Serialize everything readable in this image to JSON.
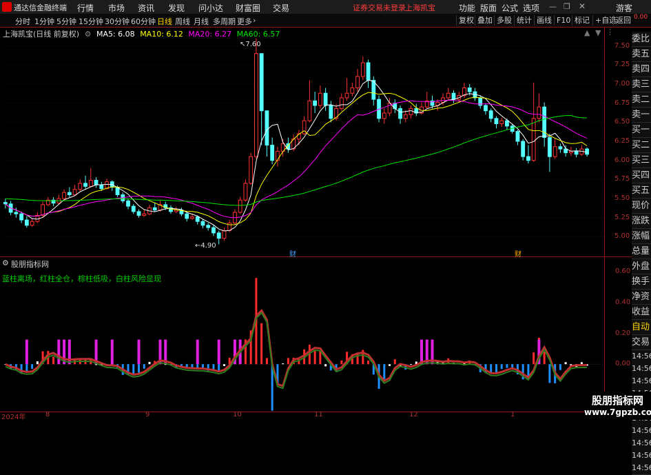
{
  "app": {
    "title": "通达信金融终端",
    "status": "证券交易未登录",
    "stock": "上海凯宝",
    "guest": "游客"
  },
  "menu": [
    "行情",
    "市场",
    "资讯",
    "发现",
    "问小达",
    "财富圈",
    "交易"
  ],
  "menu_right": [
    "功能",
    "版面",
    "公式",
    "选项"
  ],
  "periods": [
    "分时",
    "1分钟",
    "5分钟",
    "15分钟",
    "30分钟",
    "60分钟",
    "日线",
    "周线",
    "月线",
    "多周期",
    "更多"
  ],
  "active_period": "日线",
  "tools": [
    "复权",
    "叠加",
    "多股",
    "统计",
    "画线",
    "F10",
    "标记",
    "+自选",
    "返回"
  ],
  "legend": {
    "name": "上海凯宝(日线 前复权)",
    "ma5": "MA5: 6.08",
    "ma10": "MA10: 6.12",
    "ma20": "MA20: 6.27",
    "ma60": "MA60: 6.57"
  },
  "price_axis": [
    "7.50",
    "7.25",
    "7.00",
    "6.75",
    "6.50",
    "6.25",
    "6.00",
    "5.75",
    "5.50",
    "5.25",
    "5.00"
  ],
  "high_label": "7.60",
  "low_label": "4.90",
  "markers": [
    "财",
    "财"
  ],
  "indicator": {
    "name": "股朋指标网",
    "legend": "蓝柱离场，红柱全仓，棕柱低吸，白柱风险显现"
  },
  "indicator_axis": [
    "0.60",
    "0.40",
    "0.20",
    "0.00"
  ],
  "date_axis": [
    "2024年",
    "8",
    "9",
    "10",
    "11",
    "12",
    "1"
  ],
  "right_panel": [
    "委比",
    "卖五",
    "卖四",
    "卖三",
    "卖二",
    "卖一",
    "买一",
    "买二",
    "买三",
    "买四",
    "买五",
    "现价",
    "涨跌",
    "涨幅",
    "总量",
    "外盘",
    "换手",
    "净资",
    "收益",
    "自动",
    "交易"
  ],
  "right_times": [
    "14:56",
    "14:56",
    "14:56",
    "14:56",
    "14:56",
    "14:56",
    "14:56",
    "14:56",
    "14:56",
    "14:56"
  ],
  "corner": "0.00",
  "watermark": {
    "line1": "股朋指标网",
    "line2": "www.7gpzb.com"
  },
  "colors": {
    "up": "#ff3232",
    "down": "#54ffff",
    "ma5": "#ffffff",
    "ma10": "#ffff00",
    "ma20": "#ff00ff",
    "ma60": "#00e600",
    "axis": "#b03030"
  },
  "chart_data": {
    "type": "candlestick",
    "price_range": [
      4.85,
      7.65
    ],
    "candles": [
      [
        5.45,
        5.43,
        5.5,
        5.37
      ],
      [
        5.43,
        5.32,
        5.47,
        5.28
      ],
      [
        5.32,
        5.3,
        5.38,
        5.25
      ],
      [
        5.3,
        5.22,
        5.33,
        5.18
      ],
      [
        5.22,
        5.15,
        5.27,
        5.12
      ],
      [
        5.15,
        5.2,
        5.24,
        5.13
      ],
      [
        5.2,
        5.28,
        5.32,
        5.18
      ],
      [
        5.28,
        5.42,
        5.46,
        5.26
      ],
      [
        5.42,
        5.48,
        5.52,
        5.4
      ],
      [
        5.48,
        5.44,
        5.52,
        5.4
      ],
      [
        5.44,
        5.5,
        5.55,
        5.42
      ],
      [
        5.5,
        5.58,
        5.62,
        5.48
      ],
      [
        5.58,
        5.55,
        5.65,
        5.52
      ],
      [
        5.55,
        5.62,
        5.68,
        5.54
      ],
      [
        5.62,
        5.7,
        5.75,
        5.6
      ],
      [
        5.7,
        5.66,
        5.8,
        5.63
      ],
      [
        5.66,
        5.74,
        5.9,
        5.65
      ],
      [
        5.74,
        5.68,
        5.78,
        5.64
      ],
      [
        5.68,
        5.63,
        5.72,
        5.6
      ],
      [
        5.63,
        5.72,
        5.76,
        5.62
      ],
      [
        5.72,
        5.65,
        5.74,
        5.6
      ],
      [
        5.65,
        5.55,
        5.67,
        5.52
      ],
      [
        5.55,
        5.47,
        5.58,
        5.44
      ],
      [
        5.47,
        5.4,
        5.5,
        5.36
      ],
      [
        5.4,
        5.33,
        5.43,
        5.3
      ],
      [
        5.33,
        5.28,
        5.36,
        5.25
      ],
      [
        5.28,
        5.3,
        5.35,
        5.26
      ],
      [
        5.3,
        5.38,
        5.42,
        5.28
      ],
      [
        5.38,
        5.35,
        5.45,
        5.33
      ],
      [
        5.35,
        5.42,
        5.47,
        5.33
      ],
      [
        5.42,
        5.38,
        5.46,
        5.35
      ],
      [
        5.38,
        5.33,
        5.41,
        5.3
      ],
      [
        5.33,
        5.35,
        5.39,
        5.31
      ],
      [
        5.35,
        5.3,
        5.38,
        5.27
      ],
      [
        5.3,
        5.24,
        5.33,
        5.2
      ],
      [
        5.24,
        5.26,
        5.3,
        5.22
      ],
      [
        5.26,
        5.2,
        5.28,
        5.16
      ],
      [
        5.2,
        5.15,
        5.23,
        5.11
      ],
      [
        5.15,
        5.12,
        5.18,
        5.08
      ],
      [
        5.12,
        5.05,
        5.15,
        5.01
      ],
      [
        5.05,
        4.98,
        5.08,
        4.9
      ],
      [
        4.98,
        5.08,
        5.12,
        4.95
      ],
      [
        5.08,
        5.18,
        5.22,
        5.06
      ],
      [
        5.18,
        5.32,
        5.36,
        5.16
      ],
      [
        5.32,
        5.48,
        5.52,
        5.3
      ],
      [
        5.48,
        5.7,
        5.75,
        5.46
      ],
      [
        5.7,
        6.05,
        6.1,
        5.68
      ],
      [
        6.05,
        7.4,
        7.6,
        6.02
      ],
      [
        7.4,
        6.65,
        6.9,
        6.2
      ],
      [
        6.65,
        6.2,
        6.4,
        6.05
      ],
      [
        6.2,
        6.0,
        6.3,
        5.95
      ],
      [
        6.0,
        6.12,
        6.18,
        5.92
      ],
      [
        6.12,
        6.22,
        6.28,
        6.05
      ],
      [
        6.22,
        6.15,
        6.3,
        6.1
      ],
      [
        6.15,
        6.28,
        6.34,
        6.12
      ],
      [
        6.28,
        6.35,
        6.4,
        6.2
      ],
      [
        6.35,
        6.52,
        6.58,
        6.33
      ],
      [
        6.52,
        6.78,
        7.05,
        6.5
      ],
      [
        6.78,
        6.72,
        6.9,
        6.62
      ],
      [
        6.72,
        6.88,
        6.98,
        6.68
      ],
      [
        6.88,
        6.72,
        6.95,
        6.65
      ],
      [
        6.72,
        6.55,
        6.78,
        6.5
      ],
      [
        6.55,
        6.68,
        6.74,
        6.52
      ],
      [
        6.68,
        6.82,
        6.88,
        6.65
      ],
      [
        6.82,
        6.88,
        7.08,
        6.78
      ],
      [
        6.88,
        6.95,
        7.02,
        6.84
      ],
      [
        6.95,
        7.1,
        7.2,
        6.9
      ],
      [
        7.1,
        7.28,
        7.36,
        7.05
      ],
      [
        7.28,
        7.05,
        7.32,
        6.95
      ],
      [
        7.05,
        6.8,
        7.1,
        6.72
      ],
      [
        6.8,
        6.55,
        6.85,
        6.5
      ],
      [
        6.55,
        6.62,
        6.68,
        6.48
      ],
      [
        6.62,
        6.75,
        6.82,
        6.58
      ],
      [
        6.75,
        6.68,
        6.8,
        6.62
      ],
      [
        6.68,
        6.55,
        6.72,
        6.48
      ],
      [
        6.55,
        6.6,
        6.66,
        6.5
      ],
      [
        6.6,
        6.68,
        6.72,
        6.55
      ],
      [
        6.68,
        6.62,
        6.74,
        6.58
      ],
      [
        6.62,
        6.7,
        6.76,
        6.6
      ],
      [
        6.7,
        6.78,
        6.9,
        6.68
      ],
      [
        6.78,
        6.72,
        6.85,
        6.68
      ],
      [
        6.72,
        6.76,
        6.8,
        6.65
      ],
      [
        6.76,
        6.82,
        6.88,
        6.72
      ],
      [
        6.82,
        6.88,
        6.95,
        6.78
      ],
      [
        6.88,
        6.8,
        6.92,
        6.75
      ],
      [
        6.8,
        6.85,
        6.9,
        6.76
      ],
      [
        6.85,
        6.95,
        7.02,
        6.82
      ],
      [
        6.95,
        6.9,
        7.0,
        6.85
      ],
      [
        6.9,
        6.82,
        6.95,
        6.78
      ],
      [
        6.82,
        6.72,
        6.85,
        6.68
      ],
      [
        6.72,
        6.65,
        6.75,
        6.6
      ],
      [
        6.65,
        6.55,
        6.68,
        6.5
      ],
      [
        6.55,
        6.48,
        6.58,
        6.42
      ],
      [
        6.48,
        6.52,
        6.56,
        6.44
      ],
      [
        6.52,
        6.45,
        6.55,
        6.4
      ],
      [
        6.45,
        6.38,
        6.48,
        6.35
      ],
      [
        6.38,
        6.25,
        6.4,
        6.2
      ],
      [
        6.25,
        6.05,
        6.28,
        6.0
      ],
      [
        6.05,
        6.0,
        6.2,
        5.96
      ],
      [
        6.0,
        6.55,
        7.02,
        5.98
      ],
      [
        6.55,
        6.7,
        6.88,
        6.5
      ],
      [
        6.7,
        6.3,
        6.76,
        6.18
      ],
      [
        6.3,
        6.05,
        6.35,
        5.85
      ],
      [
        6.05,
        6.18,
        6.28,
        6.02
      ],
      [
        6.18,
        6.15,
        6.22,
        6.1
      ],
      [
        6.15,
        6.1,
        6.2,
        6.05
      ],
      [
        6.1,
        6.12,
        6.18,
        6.06
      ],
      [
        6.12,
        6.08,
        6.16,
        6.04
      ],
      [
        6.08,
        6.15,
        6.2,
        6.06
      ],
      [
        6.15,
        6.08,
        6.17,
        6.05
      ]
    ],
    "ma5_last": 6.08,
    "ma10_last": 6.12,
    "ma20_last": 6.27,
    "ma60_last": 6.57,
    "indicator_range": [
      -0.12,
      0.62
    ]
  }
}
